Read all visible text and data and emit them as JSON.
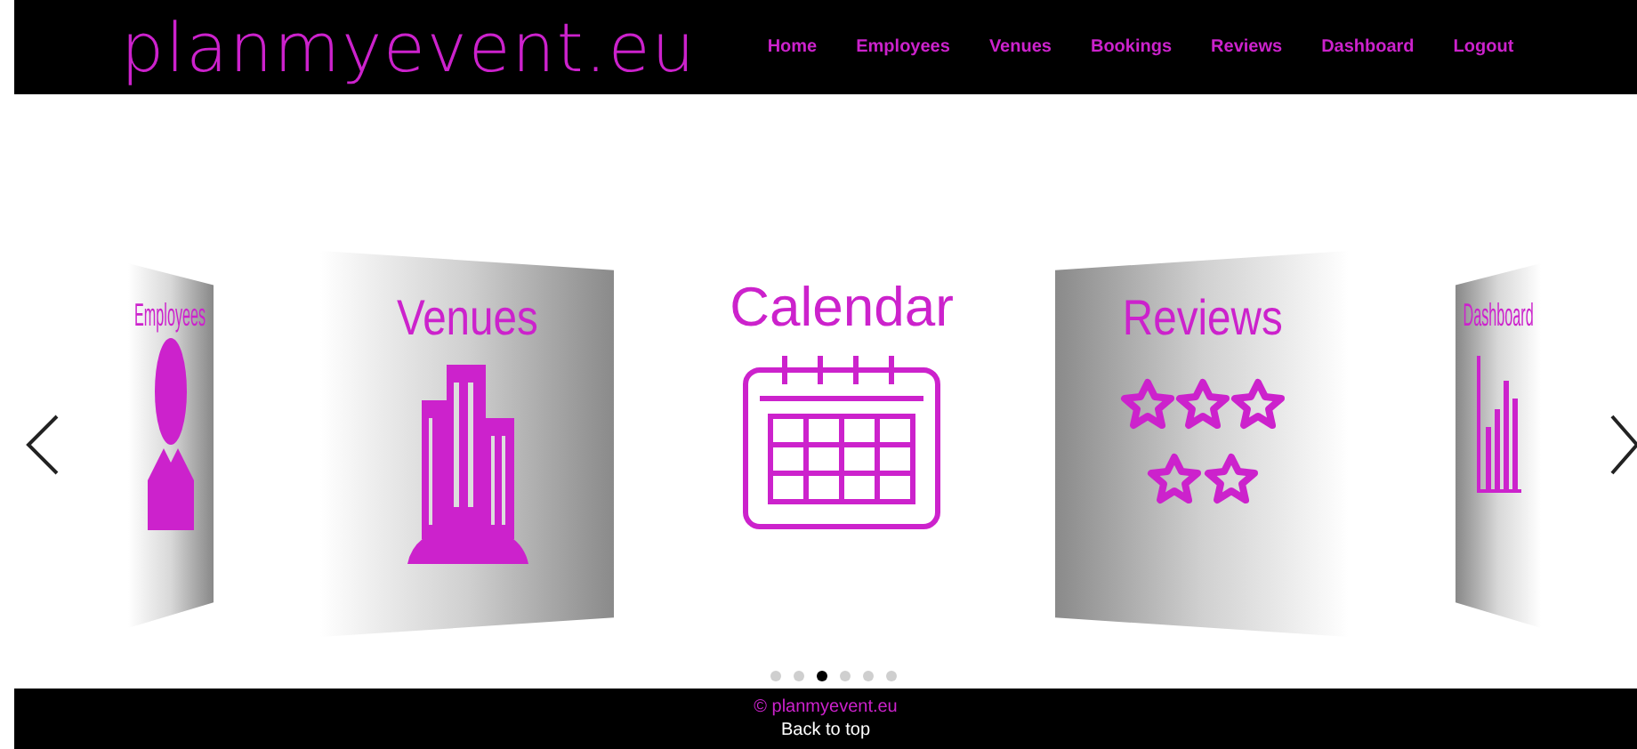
{
  "header": {
    "logo": "planmyevent.eu",
    "nav": [
      {
        "label": "Home"
      },
      {
        "label": "Employees"
      },
      {
        "label": "Venues"
      },
      {
        "label": "Bookings"
      },
      {
        "label": "Reviews"
      },
      {
        "label": "Dashboard"
      },
      {
        "label": "Logout"
      }
    ]
  },
  "carousel": {
    "slides": [
      {
        "label": "Employees",
        "kind": "person",
        "selected": false
      },
      {
        "label": "Venues",
        "kind": "buildings",
        "selected": false
      },
      {
        "label": "Calendar",
        "kind": "calendar",
        "selected": true
      },
      {
        "label": "Reviews",
        "kind": "stars",
        "selected": false
      },
      {
        "label": "Dashboard",
        "kind": "chart",
        "selected": false
      }
    ],
    "dots": [
      {
        "selected": false
      },
      {
        "selected": false
      },
      {
        "selected": true
      },
      {
        "selected": false
      },
      {
        "selected": false
      },
      {
        "selected": false
      }
    ]
  },
  "footer": {
    "copyright": "© planmyevent.eu",
    "back_to_top": "Back to top"
  }
}
